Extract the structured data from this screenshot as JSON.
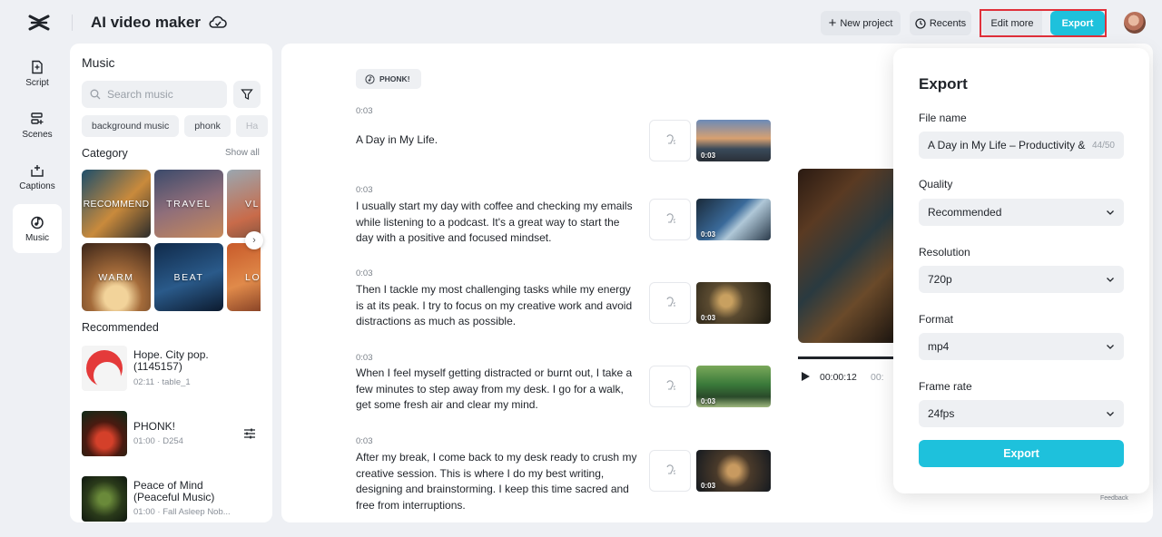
{
  "app": {
    "title": "AI video maker"
  },
  "toolbar": {
    "new_project": "New project",
    "recents": "Recents",
    "edit_more": "Edit more",
    "export": "Export"
  },
  "rail": [
    {
      "label": "Script",
      "icon": "script-icon"
    },
    {
      "label": "Scenes",
      "icon": "scenes-icon"
    },
    {
      "label": "Captions",
      "icon": "captions-icon"
    },
    {
      "label": "Music",
      "icon": "music-icon",
      "active": true
    }
  ],
  "music": {
    "title": "Music",
    "search_placeholder": "Search music",
    "chips": [
      "background music",
      "phonk",
      "Ha"
    ],
    "category_title": "Category",
    "show_all": "Show all",
    "categories": [
      "RECOMMEND",
      "TRAVEL",
      "VL",
      "WARM",
      "BEAT",
      "LO"
    ],
    "recommended_title": "Recommended",
    "tracks": [
      {
        "name": "Hope. City pop. (1145157)",
        "meta": "02:11 · table_1"
      },
      {
        "name": "PHONK!",
        "meta": "01:00 · D254"
      },
      {
        "name": "Peace of Mind (Peaceful Music)",
        "meta": "01:00 · Fall Asleep Nob..."
      }
    ]
  },
  "script": {
    "music_tag": "PHONK!",
    "scenes": [
      {
        "time": "0:03",
        "text": "A Day in My Life.",
        "duration": "0:03"
      },
      {
        "time": "0:03",
        "text": "I usually start my day with coffee and checking my emails while listening to a podcast. It's a great way to start the day with a positive and focused mindset.",
        "duration": "0:03"
      },
      {
        "time": "0:03",
        "text": "Then I tackle my most challenging tasks while my energy is at its peak. I try to focus on my creative work and avoid distractions as much as possible.",
        "duration": "0:03"
      },
      {
        "time": "0:03",
        "text": "When I feel myself getting distracted or burnt out, I take a few minutes to step away from my desk. I go for a walk, get some fresh air and clear my mind.",
        "duration": "0:03"
      },
      {
        "time": "0:03",
        "text": "After my break, I come back to my desk ready to crush my creative session. This is where I do my best writing, designing and brainstorming. I keep this time sacred and free from interruptions.",
        "duration": "0:03"
      }
    ],
    "player": {
      "current": "00:00:12",
      "total": "00:"
    },
    "feedback": "Feedback"
  },
  "export_dialog": {
    "title": "Export",
    "file_name_label": "File name",
    "file_name": "A Day in My Life – Productivity & Creativity",
    "file_name_count": "44/50",
    "quality_label": "Quality",
    "quality": "Recommended",
    "resolution_label": "Resolution",
    "resolution": "720p",
    "format_label": "Format",
    "format": "mp4",
    "frame_rate_label": "Frame rate",
    "frame_rate": "24fps",
    "export_button": "Export"
  },
  "colors": {
    "accent": "#1ec1dc",
    "highlight": "#e0303a"
  }
}
